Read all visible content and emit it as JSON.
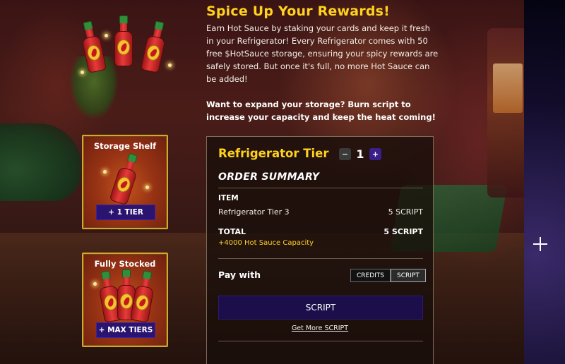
{
  "header": {
    "title": "Spice Up Your Rewards!",
    "intro": "Earn Hot Sauce by staking your cards and keep it fresh in your Refrigerator! Every Refrigerator comes with 50 free $HotSauce storage, ensuring your spicy rewards are safely stored. But once it's full, no more Hot Sauce can be added!",
    "cta": "Want to expand your storage? Burn script to increase your capacity and keep the heat coming!"
  },
  "tiers": [
    {
      "title": "Storage Shelf",
      "button_label": "+ 1 TIER"
    },
    {
      "title": "Fully Stocked",
      "button_label": "+ MAX TIERS"
    }
  ],
  "order": {
    "tier_title": "Refrigerator Tier",
    "minus_label": "−",
    "quantity": "1",
    "plus_label": "+",
    "summary_title": "ORDER SUMMARY",
    "item_header": "ITEM",
    "item_name": "Refrigerator Tier 3",
    "item_price": "5 SCRIPT",
    "total_label": "TOTAL",
    "total_price": "5 SCRIPT",
    "capacity_note": "+4000 Hot Sauce Capacity",
    "pay_label": "Pay with",
    "pay_options": [
      "CREDITS",
      "SCRIPT"
    ],
    "selected_pay_option": "SCRIPT",
    "pay_button_label": "SCRIPT",
    "more_link": "Get More SCRIPT"
  },
  "colors": {
    "accent": "#ffd21f",
    "button_purple": "#1c0e4a",
    "card_border": "#d8a62e"
  },
  "icons": [
    "hot-sauce-bottle-icon",
    "sparkle-icon",
    "plus-icon",
    "minus-icon"
  ]
}
